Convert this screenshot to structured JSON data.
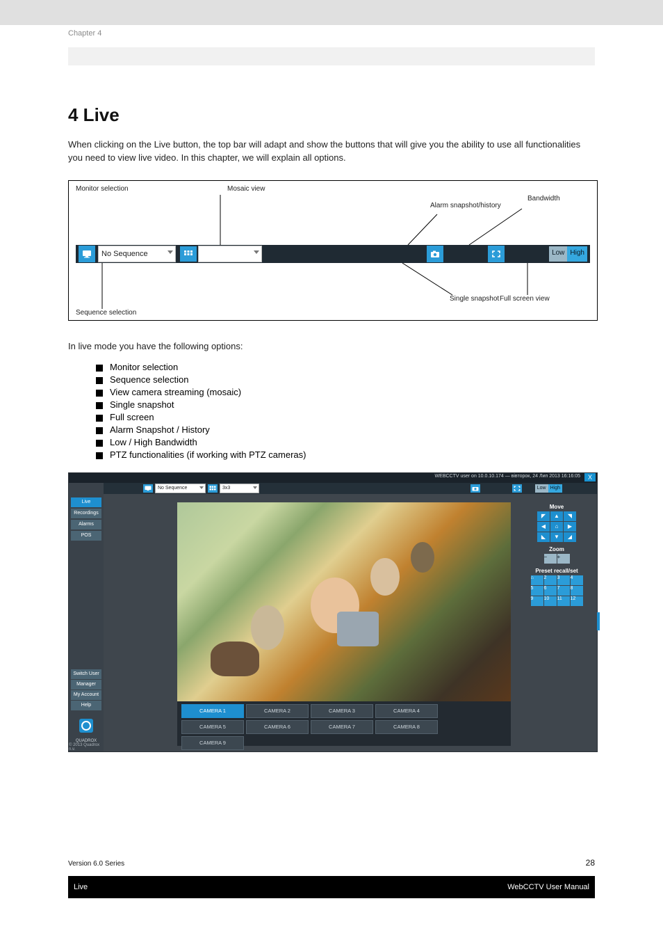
{
  "docTitle": "Chapter 4",
  "heading": "4 Live",
  "intro": "When clicking on the Live button, the top bar will adapt and show the buttons that will give you the ability to use all functionalities you need to view live video. In this chapter, we will explain all options.",
  "annot": {
    "a1": "Monitor selection",
    "a2": "Mosaic view",
    "a3": "Alarm snapshot/history",
    "a4": "Bandwidth",
    "a5": "Sequence selection",
    "a6": "Single snapshot",
    "a7": "Full screen view"
  },
  "toolbar": {
    "sequence_label": "No Sequence",
    "low_label": "Low",
    "high_label": "High"
  },
  "options_intro": "In live mode you have the following options:",
  "options": [
    "Monitor selection",
    "Sequence selection",
    "View camera streaming (mosaic)",
    "Single snapshot",
    "Full screen",
    "Alarm Snapshot / History",
    "Low / High Bandwidth",
    "PTZ functionalities (if working with PTZ cameras)"
  ],
  "app": {
    "titlebar_text": "WEBCCTV user on 10.0.10.174  —  вівторок, 24 Лип 2013  16:16:05",
    "close_label": "X",
    "sidenav_top": [
      "Live",
      "Recordings",
      "Alarms",
      "POS"
    ],
    "sidenav_active_index": 0,
    "sidenav_bottom": [
      "Switch User",
      "Manager",
      "My Account",
      "Help"
    ],
    "brand": "QUADROX",
    "copyright": "© 2013 Quadrox n.v.",
    "mtbar": {
      "sequence_label": "No Sequence",
      "mosaic_label": "3x3",
      "low": "Low",
      "high": "High"
    },
    "cameras_row1": [
      "CAMERA 1",
      "CAMERA 2",
      "CAMERA 3",
      "CAMERA 4"
    ],
    "cameras_row2": [
      "CAMERA 5",
      "CAMERA 6",
      "CAMERA 7",
      "CAMERA 8"
    ],
    "cameras_row3": [
      "CAMERA 9"
    ],
    "selected_camera_index": 0,
    "ptz": {
      "move_label": "Move",
      "move_cells": [
        "◤",
        "▲",
        "◥",
        "◀",
        "⌂",
        "▶",
        "◣",
        "▼",
        "◢"
      ],
      "zoom_label": "Zoom",
      "zoom_cells": [
        "−",
        "+"
      ],
      "preset_label": "Preset recall/set",
      "presets": [
        "⌂",
        "2",
        "3",
        "4",
        "5",
        "6",
        "7",
        "8",
        "9",
        "10",
        "11",
        "12"
      ]
    }
  },
  "version_text": "Version 6.0 Series",
  "page_number": "28",
  "footer_left": "Live",
  "footer_right": "WebCCTV User Manual",
  "chart_data": null
}
